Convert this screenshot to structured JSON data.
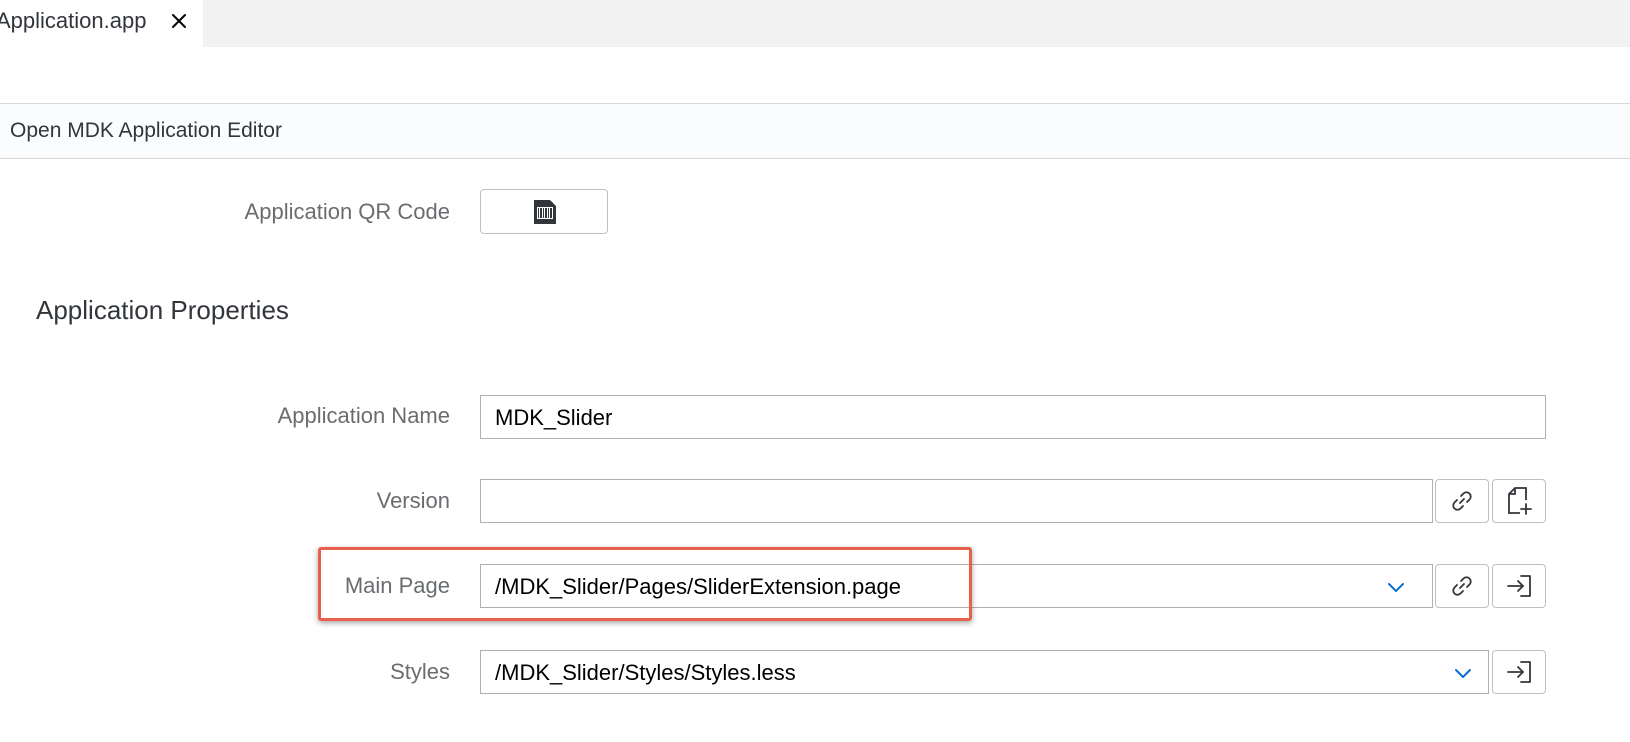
{
  "tab": {
    "title": "Application.app",
    "close_icon": "close-icon"
  },
  "editor_link": {
    "label": "Open MDK Application Editor"
  },
  "qr": {
    "label": "Application QR Code",
    "icon": "qr-code-icon"
  },
  "section": {
    "title": "Application Properties"
  },
  "fields": {
    "app_name": {
      "label": "Application Name",
      "value": "MDK_Slider"
    },
    "version": {
      "label": "Version",
      "value": "",
      "link_icon": "link-icon",
      "new_file_icon": "new-file-icon"
    },
    "main_page": {
      "label": "Main Page",
      "value": "/MDK_Slider/Pages/SliderExtension.page",
      "dropdown_icon": "chevron-down-icon",
      "link_icon": "link-icon",
      "open_icon": "open-icon"
    },
    "styles": {
      "label": "Styles",
      "value": "/MDK_Slider/Styles/Styles.less",
      "dropdown_icon": "chevron-down-icon",
      "open_icon": "open-icon"
    }
  },
  "colors": {
    "highlight": "#e8604c",
    "icon": "#32363a",
    "chevron": "#0a6ed1"
  }
}
